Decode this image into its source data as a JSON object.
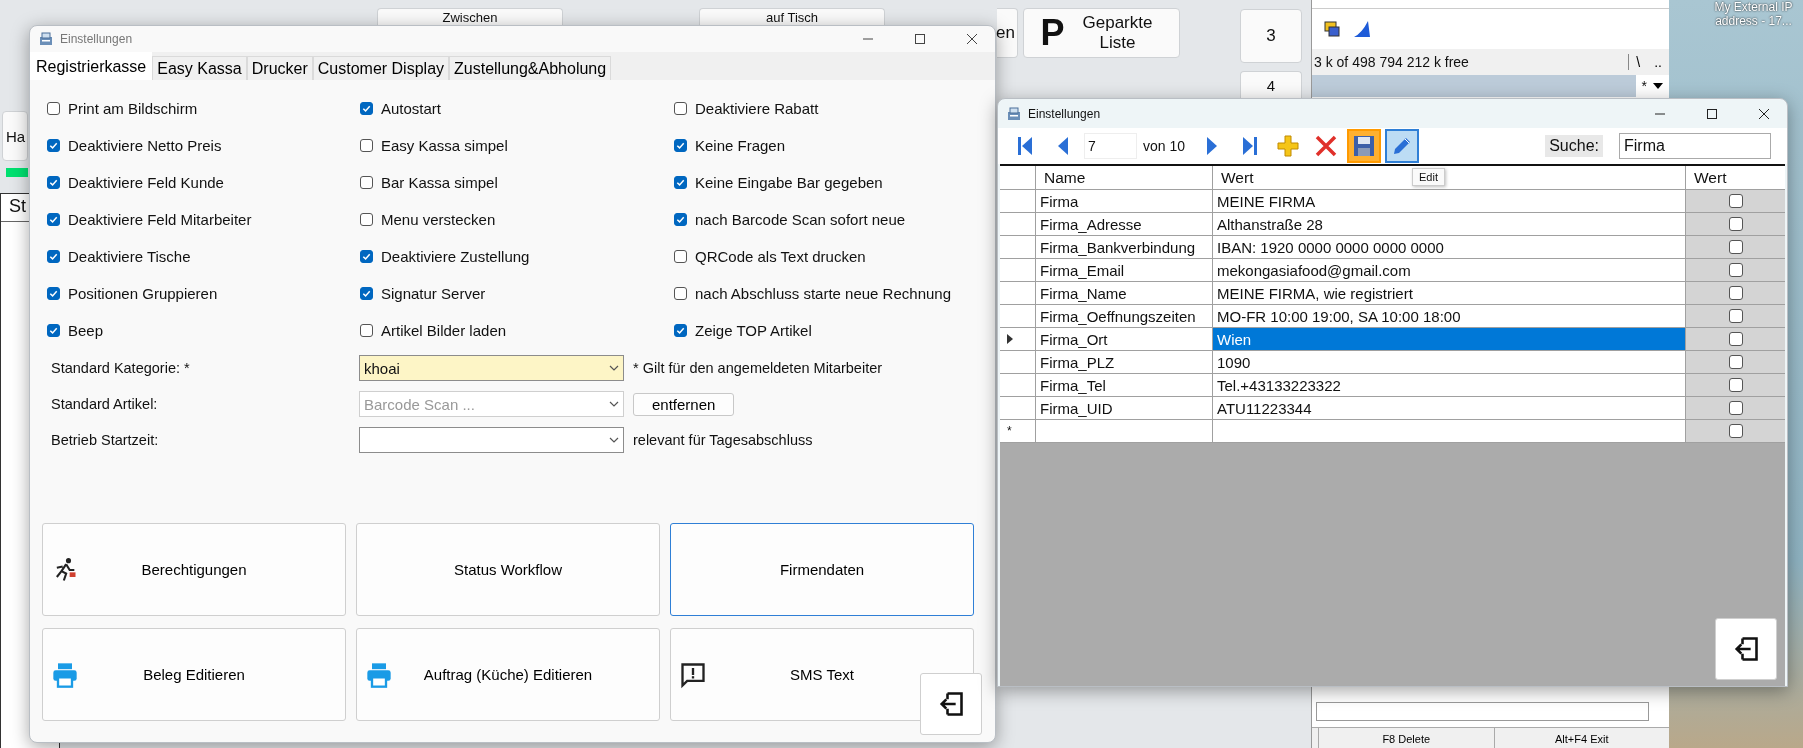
{
  "background": {
    "pos_buttons": [
      {
        "label": "Zwischen"
      },
      {
        "label": "auf Tisch"
      },
      {
        "label": "en"
      },
      {
        "icon_letter": "P",
        "label": "Geparkte Liste"
      }
    ],
    "number_buttons": [
      "3",
      "4"
    ],
    "side_button": "Ha",
    "progress": {
      "level": 1
    },
    "list_header": "St",
    "file_manager": {
      "free_space": "3 k of 498 794 212 k free",
      "path_buttons": [
        "\\",
        ".."
      ],
      "filter_marker": "*",
      "function_keys": [
        "F8 Delete",
        "Alt+F4 Exit"
      ]
    },
    "desktop_icon_label": "My External IP address - 17..."
  },
  "settings_window": {
    "title": "Einstellungen",
    "tabs": [
      {
        "label": "Registrierkasse",
        "selected": true
      },
      {
        "label": "Easy Kassa",
        "selected": false
      },
      {
        "label": "Drucker",
        "selected": false
      },
      {
        "label": "Customer Display",
        "selected": false
      },
      {
        "label": "Zustellung&Abholung",
        "selected": false
      }
    ],
    "checkbox_columns": [
      [
        {
          "label": "Print am Bildschirm",
          "checked": false
        },
        {
          "label": "Deaktiviere Netto Preis",
          "checked": true
        },
        {
          "label": "Deaktiviere Feld Kunde",
          "checked": true
        },
        {
          "label": "Deaktiviere Feld Mitarbeiter",
          "checked": true
        },
        {
          "label": "Deaktiviere Tische",
          "checked": true
        },
        {
          "label": "Positionen Gruppieren",
          "checked": true
        },
        {
          "label": "Beep",
          "checked": true
        }
      ],
      [
        {
          "label": "Autostart",
          "checked": true
        },
        {
          "label": "Easy Kassa simpel",
          "checked": false
        },
        {
          "label": "Bar Kassa simpel",
          "checked": false
        },
        {
          "label": "Menu verstecken",
          "checked": false
        },
        {
          "label": "Deaktiviere Zustellung",
          "checked": true
        },
        {
          "label": "Signatur Server",
          "checked": true
        },
        {
          "label": "Artikel Bilder laden",
          "checked": false
        }
      ],
      [
        {
          "label": "Deaktiviere Rabatt",
          "checked": false
        },
        {
          "label": "Keine Fragen",
          "checked": true
        },
        {
          "label": "Keine Eingabe Bar gegeben",
          "checked": true
        },
        {
          "label": "nach Barcode Scan sofort neue",
          "checked": true
        },
        {
          "label": "QRCode als Text drucken",
          "checked": false
        },
        {
          "label": "nach Abschluss starte neue Rechnung",
          "checked": false
        },
        {
          "label": "Zeige TOP Artikel",
          "checked": true
        }
      ]
    ],
    "fields": [
      {
        "label": "Standard Kategorie: *",
        "value": "khoai",
        "focused": true,
        "disabled": false,
        "note": "* Gilt für den angemeldeten Mitarbeiter"
      },
      {
        "label": "Standard Artikel:",
        "value": "Barcode Scan ...",
        "focused": false,
        "disabled": true,
        "button": "entfernen"
      },
      {
        "label": "Betrieb Startzeit:",
        "focused": false,
        "disabled": false,
        "note": "relevant für Tagesabschluss"
      }
    ],
    "buttons": [
      {
        "label": "Berechtigungen",
        "kind": "runner",
        "focused": false
      },
      {
        "label": "Status Workflow",
        "focused": false
      },
      {
        "label": "Firmendaten",
        "focused": true
      },
      {
        "label": "Beleg Editieren",
        "kind": "printer",
        "focused": false
      },
      {
        "label": "Auftrag (Küche) Editieren",
        "kind": "printer",
        "focused": false
      },
      {
        "label": "SMS Text",
        "kind": "message",
        "focused": false
      }
    ]
  },
  "data_window": {
    "title": "Einstellungen",
    "toolbar": {
      "buttons": [
        {
          "kind": "first",
          "pressed": false,
          "hot": false
        },
        {
          "kind": "prev",
          "pressed": false,
          "hot": false
        },
        {
          "kind": "record"
        },
        {
          "kind": "next",
          "pressed": false,
          "hot": false
        },
        {
          "kind": "last",
          "pressed": false,
          "hot": false
        },
        {
          "kind": "add",
          "pressed": false,
          "hot": false
        },
        {
          "kind": "delete",
          "pressed": false,
          "hot": false
        },
        {
          "kind": "save",
          "pressed": true,
          "hot": false
        },
        {
          "kind": "edit",
          "pressed": false,
          "hot": true
        }
      ],
      "record": "7",
      "record_count": "von 10",
      "search_label": "Suche:",
      "search_value": "Firma"
    },
    "tooltip": "Edit",
    "table": {
      "columns": [
        "Name",
        "Wert",
        "Wert"
      ],
      "rows": [
        {
          "name": "Firma",
          "value": "MEINE FIRMA",
          "checked": false,
          "selected": false
        },
        {
          "name": "Firma_Adresse",
          "value": "Althanstraße 28",
          "checked": false,
          "selected": false
        },
        {
          "name": "Firma_Bankverbindung",
          "value": "IBAN: 1920 0000 0000 0000 0000",
          "checked": false,
          "selected": false
        },
        {
          "name": "Firma_Email",
          "value": "mekongasiafood@gmail.com",
          "checked": false,
          "selected": false
        },
        {
          "name": "Firma_Name",
          "value": "MEINE FIRMA, wie registriert",
          "checked": false,
          "selected": false
        },
        {
          "name": "Firma_Oeffnungszeiten",
          "value": "MO-FR 10:00 19:00, SA 10:00 18:00",
          "checked": false,
          "selected": false
        },
        {
          "name": "Firma_Ort",
          "value": "Wien",
          "checked": false,
          "selected": true
        },
        {
          "name": "Firma_PLZ",
          "value": "1090",
          "checked": false,
          "selected": false
        },
        {
          "name": "Firma_Tel",
          "value": "Tel.+43133223322",
          "checked": false,
          "selected": false
        },
        {
          "name": "Firma_UID",
          "value": "ATU11223344",
          "checked": false,
          "selected": false
        }
      ],
      "new_row": {
        "marker": "*",
        "checked": false
      }
    }
  }
}
